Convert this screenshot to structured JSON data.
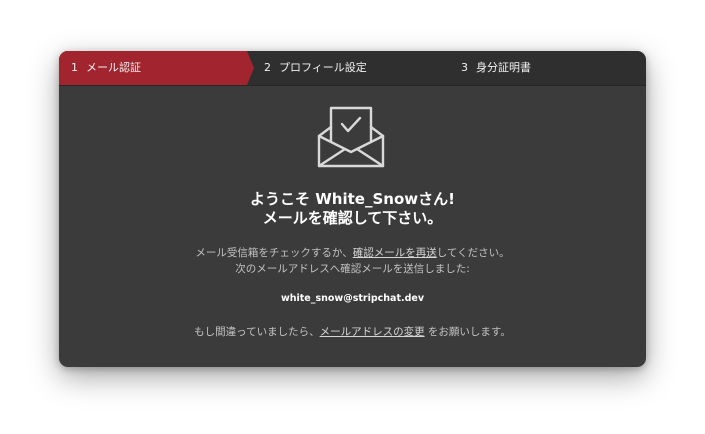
{
  "steps": [
    {
      "num": "1",
      "label": "メール認証",
      "active": true
    },
    {
      "num": "2",
      "label": "プロフィール設定",
      "active": false
    },
    {
      "num": "3",
      "label": "身分証明書",
      "active": false
    }
  ],
  "icons": {
    "envelope": "envelope-check-icon"
  },
  "heading": {
    "line1": "ようこそ White_Snowさん!",
    "line2": "メールを確認して下さい。"
  },
  "instructions": {
    "line1_before": "メール受信箱をチェックするか、",
    "resend_link": "確認メールを再送",
    "line1_after": "してください。",
    "line2": "次のメールアドレスへ確認メールを送信しました:"
  },
  "email": "white_snow@stripchat.dev",
  "footer": {
    "before": "もし間違っていましたら、",
    "change_link": "メールアドレスの変更",
    "after": " をお願いします。"
  },
  "colors": {
    "active_step": "#a2242e",
    "modal_bg": "#3b3b3b",
    "header_bg": "#2f2f2f"
  }
}
